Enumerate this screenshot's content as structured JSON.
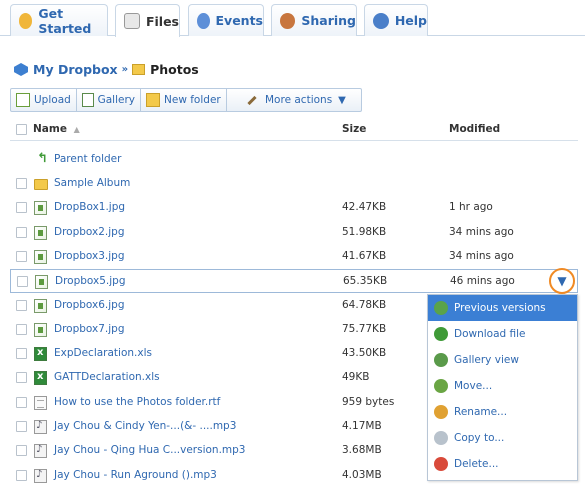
{
  "tabs": [
    {
      "label": "Get Started",
      "icon": "get-started-icon",
      "color": "#f0b63a"
    },
    {
      "label": "Files",
      "icon": "files-icon",
      "color": "#d9d9d9"
    },
    {
      "label": "Events",
      "icon": "events-icon",
      "color": "#5d8fd8"
    },
    {
      "label": "Sharing",
      "icon": "sharing-icon",
      "color": "#c8763e"
    },
    {
      "label": "Help",
      "icon": "help-icon",
      "color": "#4a7fc9"
    }
  ],
  "breadcrumb": {
    "home": "My Dropbox",
    "separator": "»",
    "current": "Photos"
  },
  "toolbar": {
    "upload": "Upload",
    "gallery": "Gallery",
    "new_folder": "New folder",
    "more_actions": "More actions"
  },
  "table": {
    "headers": {
      "name": "Name",
      "size": "Size",
      "modified": "Modified"
    },
    "parent": "Parent folder",
    "rows": [
      {
        "name": "Sample Album",
        "size": "",
        "modified": "",
        "type": "folder"
      },
      {
        "name": "DropBox1.jpg",
        "size": "42.47KB",
        "modified": "1 hr ago",
        "type": "img"
      },
      {
        "name": "Dropbox2.jpg",
        "size": "51.98KB",
        "modified": "34 mins ago",
        "type": "img"
      },
      {
        "name": "Dropbox3.jpg",
        "size": "41.67KB",
        "modified": "34 mins ago",
        "type": "img"
      },
      {
        "name": "Dropbox5.jpg",
        "size": "65.35KB",
        "modified": "46 mins ago",
        "type": "img"
      },
      {
        "name": "Dropbox6.jpg",
        "size": "64.78KB",
        "modified": "",
        "type": "img"
      },
      {
        "name": "Dropbox7.jpg",
        "size": "75.77KB",
        "modified": "",
        "type": "img"
      },
      {
        "name": "ExpDeclaration.xls",
        "size": "43.50KB",
        "modified": "",
        "type": "xls"
      },
      {
        "name": "GATTDeclaration.xls",
        "size": "49KB",
        "modified": "",
        "type": "xls"
      },
      {
        "name": "How to use the Photos folder.rtf",
        "size": "959 bytes",
        "modified": "",
        "type": "txt"
      },
      {
        "name": "Jay Chou & Cindy Yen-...(&- ....mp3",
        "size": "4.17MB",
        "modified": "",
        "type": "mp3"
      },
      {
        "name": "Jay Chou - Qing Hua C...version.mp3",
        "size": "3.68MB",
        "modified": "",
        "type": "mp3"
      },
      {
        "name": "Jay Chou - Run Aground ().mp3",
        "size": "4.03MB",
        "modified": "",
        "type": "mp3"
      }
    ]
  },
  "context_menu": {
    "items": [
      {
        "label": "Previous versions",
        "icon": "previous-versions-icon",
        "color": "#5aa34a"
      },
      {
        "label": "Download file",
        "icon": "download-icon",
        "color": "#3f9a37"
      },
      {
        "label": "Gallery view",
        "icon": "gallery-view-icon",
        "color": "#5a9a4a"
      },
      {
        "label": "Move...",
        "icon": "move-icon",
        "color": "#6aa544"
      },
      {
        "label": "Rename...",
        "icon": "rename-icon",
        "color": "#e0a132"
      },
      {
        "label": "Copy to...",
        "icon": "copy-icon",
        "color": "#b8c2cc"
      },
      {
        "label": "Delete...",
        "icon": "delete-icon",
        "color": "#d94a3a"
      }
    ]
  }
}
